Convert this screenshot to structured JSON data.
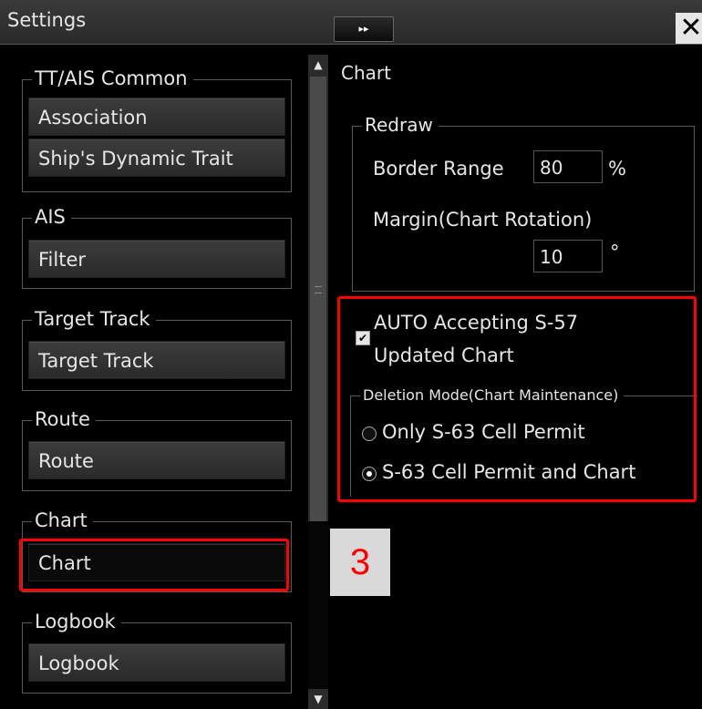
{
  "window": {
    "title": "Settings",
    "expand_label": "▸▸",
    "close_label": "✕"
  },
  "sidebar": {
    "groups": [
      {
        "legend": "TT/AIS Common",
        "buttons": [
          "Association",
          "Ship's Dynamic Trait"
        ]
      },
      {
        "legend": "AIS",
        "buttons": [
          "Filter"
        ]
      },
      {
        "legend": "Target Track",
        "buttons": [
          "Target Track"
        ]
      },
      {
        "legend": "Route",
        "buttons": [
          "Route"
        ]
      },
      {
        "legend": "Chart",
        "buttons": [
          "Chart"
        ]
      },
      {
        "legend": "Logbook",
        "buttons": [
          "Logbook"
        ]
      }
    ],
    "selected": "Chart"
  },
  "panel": {
    "title": "Chart",
    "redraw": {
      "legend": "Redraw",
      "border_range_label": "Border Range",
      "border_range_value": "80",
      "border_range_unit": "%",
      "margin_label": "Margin(Chart Rotation)",
      "margin_value": "10",
      "margin_unit": "°"
    },
    "auto_accept": {
      "checked": true,
      "line1": "AUTO Accepting S-57",
      "line2": "Updated Chart"
    },
    "deletion_mode": {
      "legend": "Deletion Mode(Chart Maintenance)",
      "options": [
        "Only S-63 Cell Permit",
        "S-63 Cell Permit and Chart"
      ],
      "selected_index": 1
    }
  },
  "annotation": {
    "step_number": "3",
    "highlight_color": "#ff0000"
  }
}
